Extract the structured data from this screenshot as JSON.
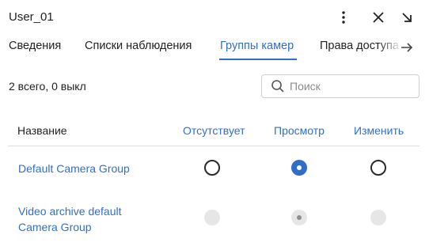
{
  "header": {
    "title": "User_01",
    "icons": [
      "more-vertical-icon",
      "close-icon",
      "collapse-arrow-icon"
    ]
  },
  "tabs": [
    {
      "label": "Сведения",
      "active": false
    },
    {
      "label": "Списки наблюдения",
      "active": false
    },
    {
      "label": "Группы камер",
      "active": true
    },
    {
      "label": "Права доступа",
      "active": false
    }
  ],
  "summary": "2 всего, 0 выкл",
  "search": {
    "placeholder": "Поиск",
    "value": ""
  },
  "table": {
    "columns": [
      "Название",
      "Отсутствует",
      "Просмотр",
      "Изменить"
    ],
    "rows": [
      {
        "name_lines": [
          "Default Camera Group"
        ],
        "selected": "Просмотр",
        "disabled": false
      },
      {
        "name_lines": [
          "Video archive default",
          "Camera Group"
        ],
        "selected": "Просмотр",
        "disabled": true
      }
    ]
  },
  "colors": {
    "accent": "#2f6fc9",
    "text": "#222222",
    "divider": "#dcdcdc",
    "disabled": "#e6e6e6"
  }
}
